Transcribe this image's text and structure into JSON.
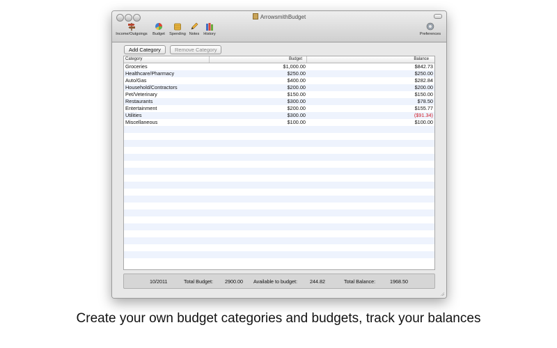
{
  "window": {
    "title": "ArrowsmithBudget"
  },
  "toolbar": {
    "items": [
      {
        "label": "Income/Outgoings",
        "icon": "signpost-icon"
      },
      {
        "label": "Budget",
        "icon": "pie-chart-icon"
      },
      {
        "label": "Spending",
        "icon": "coins-icon"
      },
      {
        "label": "Notes",
        "icon": "pencil-icon"
      },
      {
        "label": "History",
        "icon": "books-icon"
      }
    ],
    "preferences_label": "Preferences"
  },
  "buttons": {
    "add_category": "Add Category",
    "remove_category": "Remove Category"
  },
  "table": {
    "headers": [
      "Category",
      "Budget",
      "Balance"
    ],
    "rows": [
      {
        "category": "Groceries",
        "budget": "$1,000.00",
        "balance": "$842.73"
      },
      {
        "category": "Healthcare/Pharmacy",
        "budget": "$250.00",
        "balance": "$250.00"
      },
      {
        "category": "Auto/Gas",
        "budget": "$400.00",
        "balance": "$282.84"
      },
      {
        "category": "Household/Contractors",
        "budget": "$200.00",
        "balance": "$200.00"
      },
      {
        "category": "Pet/Veterinary",
        "budget": "$150.00",
        "balance": "$150.00"
      },
      {
        "category": "Restaurants",
        "budget": "$300.00",
        "balance": "$78.50"
      },
      {
        "category": "Entertainment",
        "budget": "$200.00",
        "balance": "$155.77"
      },
      {
        "category": "Utilities",
        "budget": "$300.00",
        "balance": "($91.34)"
      },
      {
        "category": "Miscellaneous",
        "budget": "$100.00",
        "balance": "$100.00"
      }
    ]
  },
  "footer": {
    "period": "10/2011",
    "total_budget_label": "Total Budget:",
    "total_budget_value": "2900.00",
    "available_label": "Available to budget:",
    "available_value": "244.82",
    "total_balance_label": "Total Balance:",
    "total_balance_value": "1968.50"
  },
  "caption": "Create your own budget categories and budgets, track your balances",
  "colors": {
    "row_stripe": "#eef3fd",
    "negative": "#d0202a"
  }
}
